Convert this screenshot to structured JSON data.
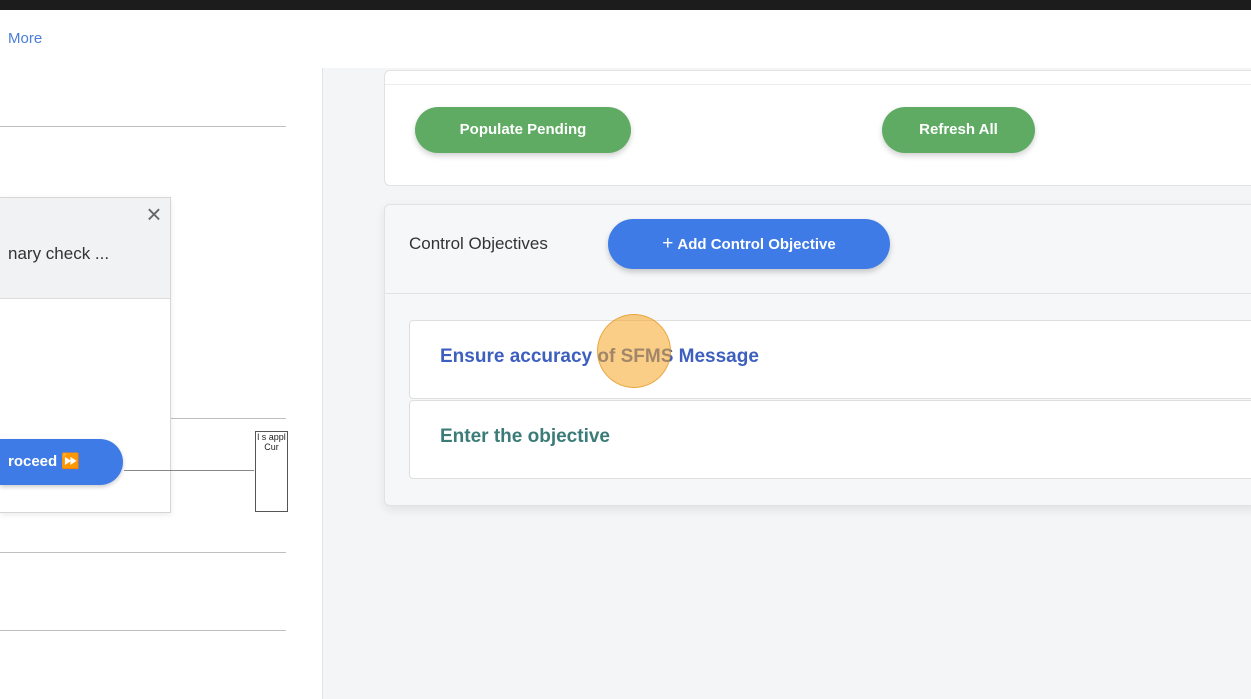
{
  "topbar": {
    "more_label": "More"
  },
  "left_panel": {
    "popup": {
      "title": "nary check ...",
      "close_glyph": "×",
      "proceed_label": "roceed ⏩"
    },
    "diagram_box_text": "l s appl Cur"
  },
  "actions": {
    "populate_pending_label": "Populate Pending",
    "refresh_all_label": "Refresh All"
  },
  "control_objectives": {
    "title": "Control Objectives",
    "add_button_plus": "+",
    "add_button_label": "Add Control Objective",
    "items": [
      {
        "label": "Ensure accuracy of SFMS Message"
      },
      {
        "label": "Enter the objective"
      }
    ]
  },
  "colors": {
    "accent_blue": "#3f7be6",
    "green": "#5fab63",
    "link_blue": "#3d5fbf",
    "link_teal": "#3b7c78",
    "cursor_highlight": "#f5a623"
  }
}
